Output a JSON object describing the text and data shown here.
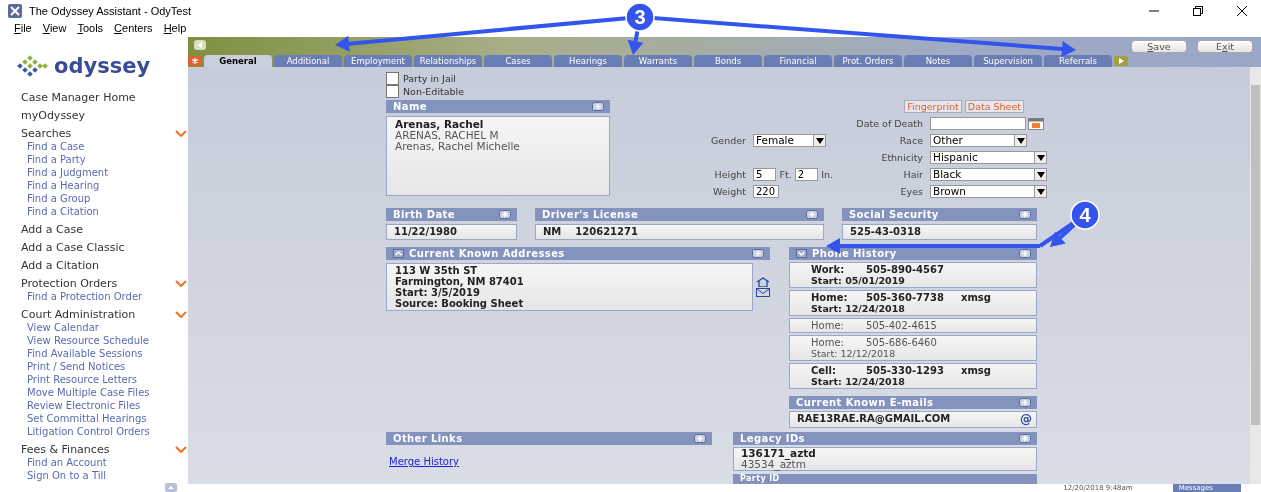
{
  "window": {
    "title": "The Odyssey Assistant - OdyTest"
  },
  "menu": [
    {
      "key": "F",
      "after": "ile"
    },
    {
      "key": "V",
      "after": "iew"
    },
    {
      "key": "T",
      "after": "ools"
    },
    {
      "key": "C",
      "after": "enters"
    },
    {
      "key": "H",
      "after": "elp"
    }
  ],
  "logo": {
    "text": "odyssey"
  },
  "sidebar": {
    "items": [
      {
        "label": "Case Manager Home",
        "kind": "link"
      },
      {
        "label": "myOdyssey",
        "kind": "link"
      },
      {
        "label": "Searches",
        "kind": "group",
        "expanded": true,
        "children": [
          {
            "label": "Find a Case"
          },
          {
            "label": "Find a Party"
          },
          {
            "label": "Find a Judgment"
          },
          {
            "label": "Find a Hearing"
          },
          {
            "label": "Find a Group"
          },
          {
            "label": "Find a Citation"
          }
        ]
      },
      {
        "label": "Add a Case",
        "kind": "link"
      },
      {
        "label": "Add a Case Classic",
        "kind": "link"
      },
      {
        "label": "Add a Citation",
        "kind": "link"
      },
      {
        "label": "Protection Orders",
        "kind": "group",
        "expanded": true,
        "children": [
          {
            "label": "Find a Protection Order"
          }
        ]
      },
      {
        "label": "Court Administration",
        "kind": "group",
        "expanded": true,
        "children": [
          {
            "label": "View Calendar"
          },
          {
            "label": "View Resource Schedule"
          },
          {
            "label": "Find Available Sessions"
          },
          {
            "label": "Print / Send Notices"
          },
          {
            "label": "Print Resource Letters"
          },
          {
            "label": "Move Multiple Case Files"
          },
          {
            "label": "Review Electronic Files"
          },
          {
            "label": "Set Committal Hearings"
          },
          {
            "label": "Litigation Control Orders"
          }
        ]
      },
      {
        "label": "Fees & Finances",
        "kind": "group",
        "expanded": true,
        "children": [
          {
            "label": "Find an Account"
          },
          {
            "label": "Sign On to a Till"
          }
        ]
      }
    ]
  },
  "toolbar_buttons": [
    {
      "key": "S",
      "after": "ave"
    },
    {
      "before": "E",
      "key": "x",
      "after": "it"
    }
  ],
  "tabs": [
    {
      "label": "General",
      "selected": true
    },
    {
      "label": "Additional",
      "selected": false
    },
    {
      "label": "Employment",
      "selected": false
    },
    {
      "label": "Relationships",
      "selected": false
    },
    {
      "label": "Cases",
      "selected": false
    },
    {
      "label": "Hearings",
      "selected": false
    },
    {
      "label": "Warrants",
      "selected": false
    },
    {
      "label": "Bonds",
      "selected": false
    },
    {
      "label": "Financial",
      "selected": false
    },
    {
      "label": "Prot. Orders",
      "selected": false
    },
    {
      "label": "Notes",
      "selected": false
    },
    {
      "label": "Supervision",
      "selected": false
    },
    {
      "label": "Referrals",
      "selected": false
    }
  ],
  "flags": [
    {
      "label": "Party in Jail",
      "checked": false
    },
    {
      "label": "Non-Editable",
      "checked": false
    }
  ],
  "name_panel": {
    "title": "Name",
    "names": [
      {
        "text": "Arenas, Rachel",
        "primary": true
      },
      {
        "text": "ARENAS, RACHEL M",
        "primary": false
      },
      {
        "text": "Arenas, Rachel Michelle",
        "primary": false
      }
    ]
  },
  "action_links": [
    "Fingerprint",
    "Data Sheet"
  ],
  "gender": {
    "label": "Gender",
    "value": "Female"
  },
  "height": {
    "label": "Height",
    "feet": "5",
    "feet_unit": "Ft.",
    "inches": "2",
    "inches_unit": "In."
  },
  "weight": {
    "label": "Weight",
    "value": "220"
  },
  "date_of_death": {
    "label": "Date of Death"
  },
  "race": {
    "label": "Race",
    "value": "Other"
  },
  "ethnicity": {
    "label": "Ethnicity",
    "value": "Hispanic"
  },
  "hair": {
    "label": "Hair",
    "value": "Black"
  },
  "eyes": {
    "label": "Eyes",
    "value": "Brown"
  },
  "birth_date": {
    "title": "Birth Date",
    "value": "11/22/1980"
  },
  "drivers_license": {
    "title": "Driver's License",
    "state": "NM",
    "number": "120621271"
  },
  "social_security": {
    "title": "Social Security",
    "value": "525-43-0318"
  },
  "addresses": {
    "title": "Current Known Addresses",
    "expanded": true,
    "lines": [
      "113 W 35th ST",
      "Farmington, NM 87401",
      "Start: 3/5/2019",
      "Source: Booking Sheet"
    ]
  },
  "phone_history": {
    "title": "Phone History",
    "expanded": false,
    "rows": [
      {
        "type": "Work:",
        "number": "505-890-4567",
        "start": "Start: 05/01/2019",
        "active": true
      },
      {
        "type": "Home:",
        "number": "505-360-7738",
        "flag": "xmsg",
        "start": "Start: 12/24/2018",
        "active": true
      },
      {
        "type": "Home:",
        "number": "505-402-4615",
        "active": false
      },
      {
        "type": "Home:",
        "number": "505-686-6460",
        "start": "Start: 12/12/2018",
        "active": false
      },
      {
        "type": "Cell:",
        "number": "505-330-1293",
        "flag": "xmsg",
        "start": "Start: 12/24/2018",
        "active": true
      }
    ]
  },
  "emails": {
    "title": "Current Known E-mails",
    "rows": [
      {
        "address": "RAE13RAE.RA@GMAIL.COM",
        "icon": "@"
      }
    ]
  },
  "other_links": {
    "title": "Other Links",
    "links": [
      "Merge History"
    ]
  },
  "legacy_ids": {
    "title": "Legacy IDs",
    "rows": [
      {
        "text": "136171_aztd",
        "primary": true
      },
      {
        "text": "43534_aztm",
        "primary": false
      }
    ]
  },
  "party_id": {
    "title": "Party ID"
  },
  "status_bar": {
    "time": "12/20/2018 9:48am",
    "messages": "Messages"
  },
  "annotations": [
    {
      "label": "3"
    },
    {
      "label": "4"
    }
  ]
}
